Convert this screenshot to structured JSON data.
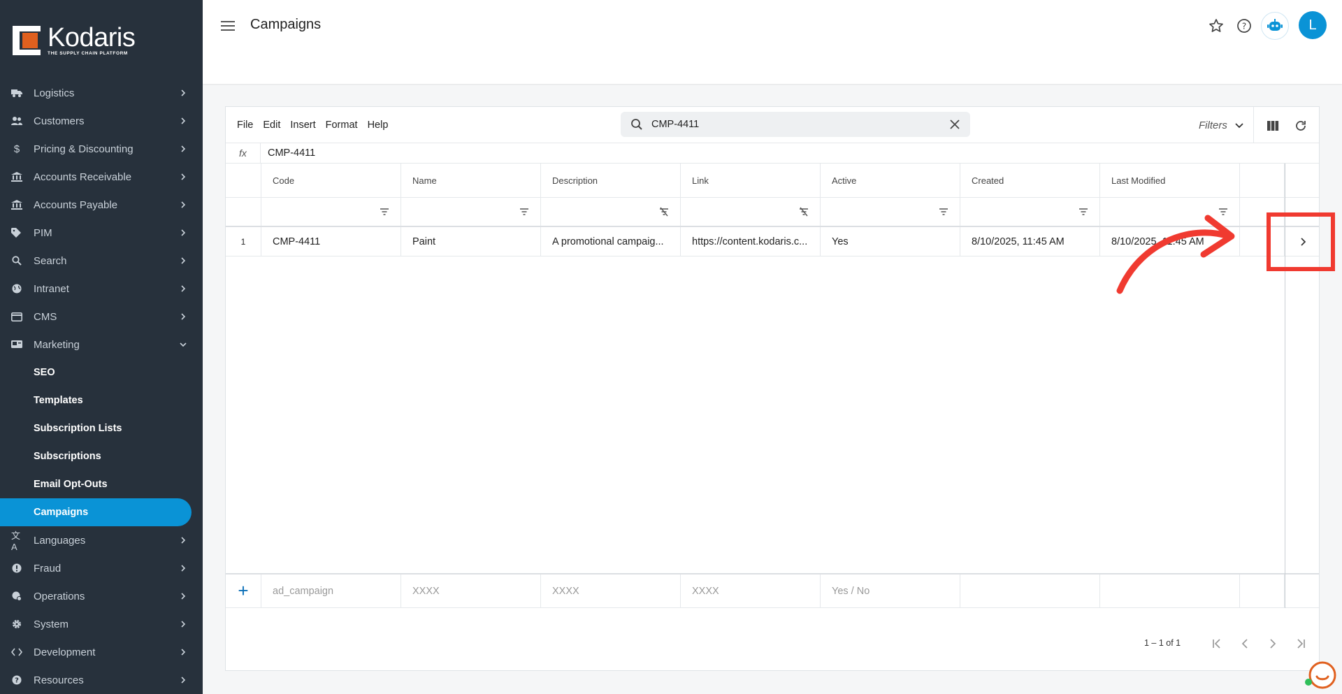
{
  "brand": {
    "name": "Kodaris",
    "tagline": "THE SUPPLY CHAIN PLATFORM",
    "accent": "#0a93d6",
    "sidebar_bg": "#27313c",
    "logo_orange": "#e0601f"
  },
  "sidebar": {
    "items": [
      {
        "label": "Logistics",
        "icon": "truck-icon"
      },
      {
        "label": "Customers",
        "icon": "people-icon"
      },
      {
        "label": "Pricing & Discounting",
        "icon": "dollar-icon"
      },
      {
        "label": "Accounts Receivable",
        "icon": "bank-icon"
      },
      {
        "label": "Accounts Payable",
        "icon": "bank-icon"
      },
      {
        "label": "PIM",
        "icon": "tag-icon"
      },
      {
        "label": "Search",
        "icon": "search-icon"
      },
      {
        "label": "Intranet",
        "icon": "globe-icon"
      },
      {
        "label": "CMS",
        "icon": "cms-icon"
      },
      {
        "label": "Marketing",
        "icon": "marketing-icon",
        "expanded": true
      }
    ],
    "marketing_sub": [
      {
        "label": "SEO"
      },
      {
        "label": "Templates"
      },
      {
        "label": "Subscription Lists"
      },
      {
        "label": "Subscriptions"
      },
      {
        "label": "Email Opt-Outs"
      },
      {
        "label": "Campaigns",
        "active": true
      }
    ],
    "items_after": [
      {
        "label": "Languages",
        "icon": "translate-icon"
      },
      {
        "label": "Fraud",
        "icon": "alert-icon"
      },
      {
        "label": "Operations",
        "icon": "operations-icon"
      },
      {
        "label": "System",
        "icon": "gear-icon"
      },
      {
        "label": "Development",
        "icon": "code-icon"
      },
      {
        "label": "Resources",
        "icon": "help-icon"
      }
    ]
  },
  "header": {
    "title": "Campaigns",
    "avatar_initial": "L"
  },
  "toolbar": {
    "menu": [
      "File",
      "Edit",
      "Insert",
      "Format",
      "Help"
    ],
    "search_value": "CMP-4411",
    "filters_label": "Filters"
  },
  "formula_bar": {
    "label": "fx",
    "value": "CMP-4411"
  },
  "table": {
    "columns": [
      "Code",
      "Name",
      "Description",
      "Link",
      "Active",
      "Created",
      "Last Modified"
    ],
    "rows": [
      {
        "num": "1",
        "cells": [
          "CMP-4411",
          "Paint",
          "A promotional campaig...",
          "https://content.kodaris.c...",
          "Yes",
          "8/10/2025, 11:45 AM",
          "8/10/2025, 11:45 AM"
        ]
      }
    ],
    "new_row_placeholders": [
      "ad_campaign",
      "XXXX",
      "XXXX",
      "XXXX",
      "Yes / No",
      "",
      ""
    ]
  },
  "pager": {
    "range_text": "1 – 1 of 1"
  },
  "annotation": {
    "color": "#f03a30"
  }
}
